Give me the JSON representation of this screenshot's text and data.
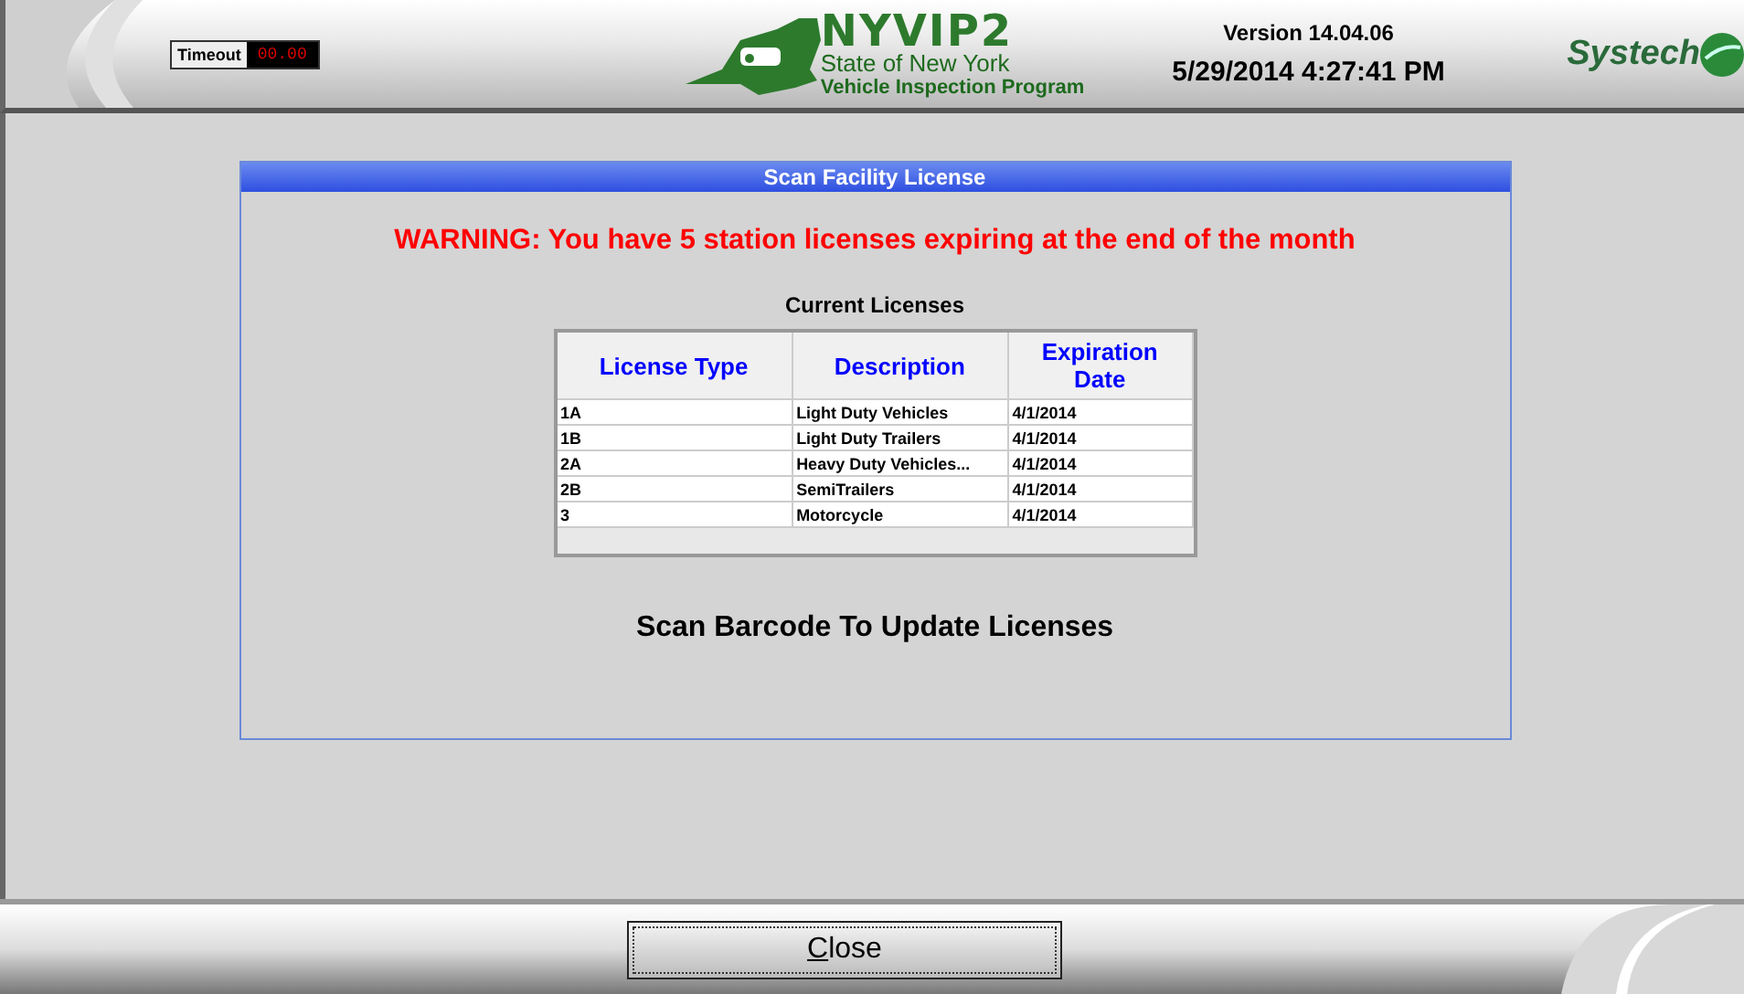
{
  "header": {
    "timeout_label": "Timeout",
    "timeout_value": "00.00",
    "logo_title": "NYVIP2",
    "logo_line_1": "State of New York",
    "logo_line_2": "Vehicle Inspection Program",
    "version": "Version 14.04.06",
    "datetime": "5/29/2014 4:27:41 PM",
    "brand": "Systech"
  },
  "dialog": {
    "title": "Scan Facility License",
    "warning": "WARNING: You have 5 station licenses expiring at the end of the month",
    "table_title": "Current Licenses",
    "columns": [
      "License Type",
      "Description",
      "Expiration Date"
    ],
    "rows": [
      [
        "1A",
        "Light Duty Vehicles",
        "4/1/2014"
      ],
      [
        "1B",
        "Light Duty Trailers",
        "4/1/2014"
      ],
      [
        "2A",
        "Heavy Duty Vehicles...",
        "4/1/2014"
      ],
      [
        "2B",
        "SemiTrailers",
        "4/1/2014"
      ],
      [
        "3",
        "Motorcycle",
        "4/1/2014"
      ]
    ],
    "instruction": "Scan Barcode To Update Licenses"
  },
  "footer": {
    "button": "Close"
  }
}
